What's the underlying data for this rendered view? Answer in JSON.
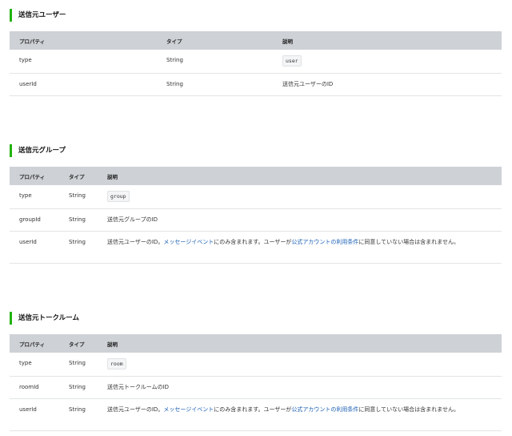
{
  "sections": [
    {
      "title": "送信元ユーザー",
      "headers": [
        "プロパティ",
        "タイプ",
        "説明"
      ],
      "rows": [
        {
          "prop": "type",
          "type": "String",
          "code": "user"
        },
        {
          "prop": "userId",
          "type": "String",
          "desc": "送信元ユーザーのID"
        }
      ]
    },
    {
      "title": "送信元グループ",
      "headers": [
        "プロパティ",
        "タイプ",
        "説明"
      ],
      "rows": [
        {
          "prop": "type",
          "type": "String",
          "code": "group"
        },
        {
          "prop": "groupId",
          "type": "String",
          "desc": "送信元グループのID"
        },
        {
          "prop": "userId",
          "type": "String",
          "desc_parts": [
            "送信元ユーザーのID。",
            "メッセージイベント",
            "にのみ含まれます。ユーザーが",
            "公式アカウントの利用条件",
            "に同意していない場合は含まれません。"
          ]
        }
      ]
    },
    {
      "title": "送信元トークルーム",
      "headers": [
        "プロパティ",
        "タイプ",
        "説明"
      ],
      "rows": [
        {
          "prop": "type",
          "type": "String",
          "code": "room"
        },
        {
          "prop": "roomId",
          "type": "String",
          "desc": "送信元トークルームのID"
        },
        {
          "prop": "userId",
          "type": "String",
          "desc_parts": [
            "送信元ユーザーのID。",
            "メッセージイベント",
            "にのみ含まれます。ユーザーが",
            "公式アカウントの利用条件",
            "に同意していない場合は含まれません。"
          ]
        }
      ]
    }
  ]
}
